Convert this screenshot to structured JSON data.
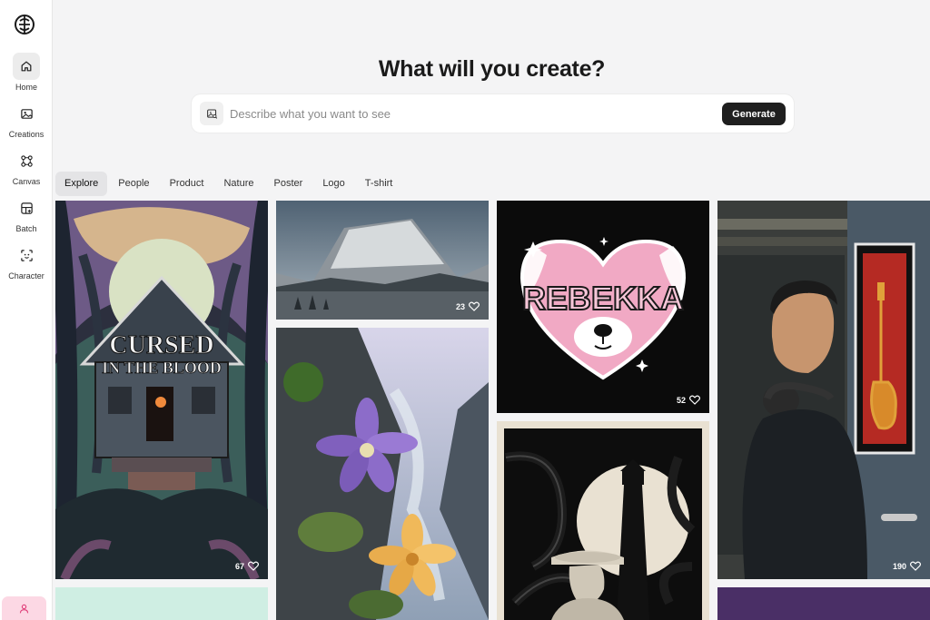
{
  "sidebar": {
    "items": [
      {
        "label": "Home",
        "icon": "home-icon",
        "active": true
      },
      {
        "label": "Creations",
        "icon": "image-icon",
        "active": false
      },
      {
        "label": "Canvas",
        "icon": "canvas-icon",
        "active": false
      },
      {
        "label": "Batch",
        "icon": "batch-icon",
        "active": false
      },
      {
        "label": "Character",
        "icon": "character-icon",
        "active": false
      }
    ],
    "profile_icon": "user-icon"
  },
  "hero": {
    "title": "What will you create?"
  },
  "search": {
    "placeholder": "Describe what you want to see",
    "generate_label": "Generate"
  },
  "tabs": [
    {
      "label": "Explore",
      "active": true
    },
    {
      "label": "People",
      "active": false
    },
    {
      "label": "Product",
      "active": false
    },
    {
      "label": "Nature",
      "active": false
    },
    {
      "label": "Poster",
      "active": false
    },
    {
      "label": "Logo",
      "active": false
    },
    {
      "label": "T-shirt",
      "active": false
    }
  ],
  "gallery": [
    {
      "subject": "cursed-cabin-poster",
      "title_line1": "CURSED",
      "title_line2": "IN THE BLOOD",
      "likes": "67"
    },
    {
      "subject": "mountain-landscape",
      "likes": "23"
    },
    {
      "subject": "rebekka-dog-logo",
      "text": "REBEKKA",
      "likes": "52"
    },
    {
      "subject": "man-with-headphones",
      "likes": "190"
    },
    {
      "subject": "flowers-canyon"
    },
    {
      "subject": "lighthouse-tentacles-poster"
    },
    {
      "subject": "mint-card"
    },
    {
      "subject": "purple-card"
    }
  ],
  "colors": {
    "accent_dark": "#1f1f1f",
    "profile_pink": "#fcd8e4",
    "active_tab": "#e4e4e6"
  }
}
